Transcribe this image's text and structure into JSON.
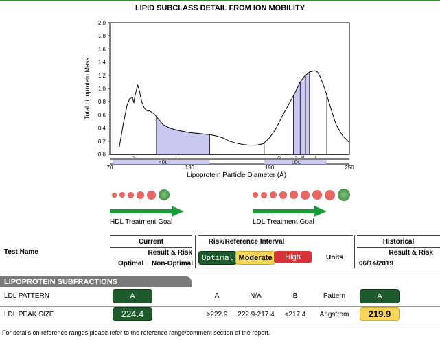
{
  "title": "LIPID SUBCLASS DETAIL FROM ION MOBILITY",
  "chart_data": {
    "type": "area",
    "title": "LIPID SUBCLASS DETAIL FROM ION MOBILITY",
    "xlabel": "Lipoprotein Particle Diameter (Å)",
    "ylabel": "Total Lipoprotein Mass",
    "xlim": [
      70,
      250
    ],
    "ylim": [
      0,
      2.0
    ],
    "x_ticks": [
      "70",
      "130",
      "190",
      "250"
    ],
    "y_ticks": [
      "0.0",
      "0.2",
      "0.4",
      "0.6",
      "0.8",
      "1.0",
      "1.2",
      "1.4",
      "1.6",
      "1.8",
      "2.0"
    ],
    "series": [
      {
        "x": [
          77,
          80,
          83,
          85,
          87,
          88,
          89,
          91,
          92,
          94,
          96,
          98,
          100,
          103,
          106,
          110,
          115,
          120,
          125,
          130,
          135,
          140,
          145,
          150,
          155,
          160,
          165,
          170,
          175,
          180,
          185,
          190,
          195,
          200,
          205,
          210,
          213,
          216,
          220,
          224,
          226,
          228,
          230,
          233,
          236,
          240,
          245,
          250
        ],
        "y": [
          0.1,
          0.45,
          0.75,
          0.85,
          0.86,
          0.78,
          0.9,
          1.05,
          0.98,
          0.8,
          0.7,
          0.66,
          0.66,
          0.62,
          0.55,
          0.45,
          0.4,
          0.37,
          0.35,
          0.33,
          0.32,
          0.31,
          0.3,
          0.28,
          0.25,
          0.2,
          0.17,
          0.15,
          0.14,
          0.14,
          0.16,
          0.25,
          0.4,
          0.6,
          0.78,
          0.97,
          1.1,
          1.18,
          1.25,
          1.27,
          1.25,
          1.18,
          1.08,
          0.9,
          0.7,
          0.45,
          0.28,
          0.18
        ]
      }
    ],
    "shaded_regions": [
      {
        "label": "HDL L",
        "x_from": 105,
        "x_to": 145
      },
      {
        "label": "LDL",
        "x_from": 208,
        "x_to": 220
      }
    ],
    "band_labels": {
      "hdl_sub": [
        "S",
        "L"
      ],
      "hdl": "HDL",
      "ldl_sub": [
        "VS",
        "S",
        "M",
        "L"
      ],
      "ldl": "LDL"
    }
  },
  "goals": {
    "hdl_label": "HDL Treatment Goal",
    "ldl_label": "LDL Treatment Goal"
  },
  "table": {
    "test_name_header": "Test Name",
    "current_header": "Current",
    "result_risk": "Result & Risk",
    "optimal": "Optimal",
    "non_optimal": "Non-Optimal",
    "risk_header": "Risk/Reference Interval",
    "units_header": "Units",
    "historical_header": "Historical",
    "hist_result_risk": "Result & Risk",
    "hist_date": "06/14/2019",
    "legend": {
      "optimal": "Optimal",
      "moderate": "Moderate",
      "high": "High"
    },
    "section": "LIPOPROTEIN SUBFRACTIONS",
    "rows": [
      {
        "name": "LDL PATTERN",
        "current": "A",
        "a": "A",
        "b": "N/A",
        "c": "B",
        "units": "Pattern",
        "hist": "A"
      },
      {
        "name": "LDL PEAK SIZE",
        "current": "224.4",
        "a": ">222.9",
        "b": "222.9-217.4",
        "c": "<217.4",
        "units": "Angstrom",
        "hist": "219.9"
      }
    ]
  },
  "footer": "For details on reference ranges please refer to the reference range/comment section of the report.",
  "colors": {
    "optimal": "#1e5a2c",
    "moderate": "#f5d65a",
    "high": "#d9333a",
    "shade": "#c8c8f0",
    "arrow": "#1f9a3a",
    "dot": "#e24b4b"
  }
}
